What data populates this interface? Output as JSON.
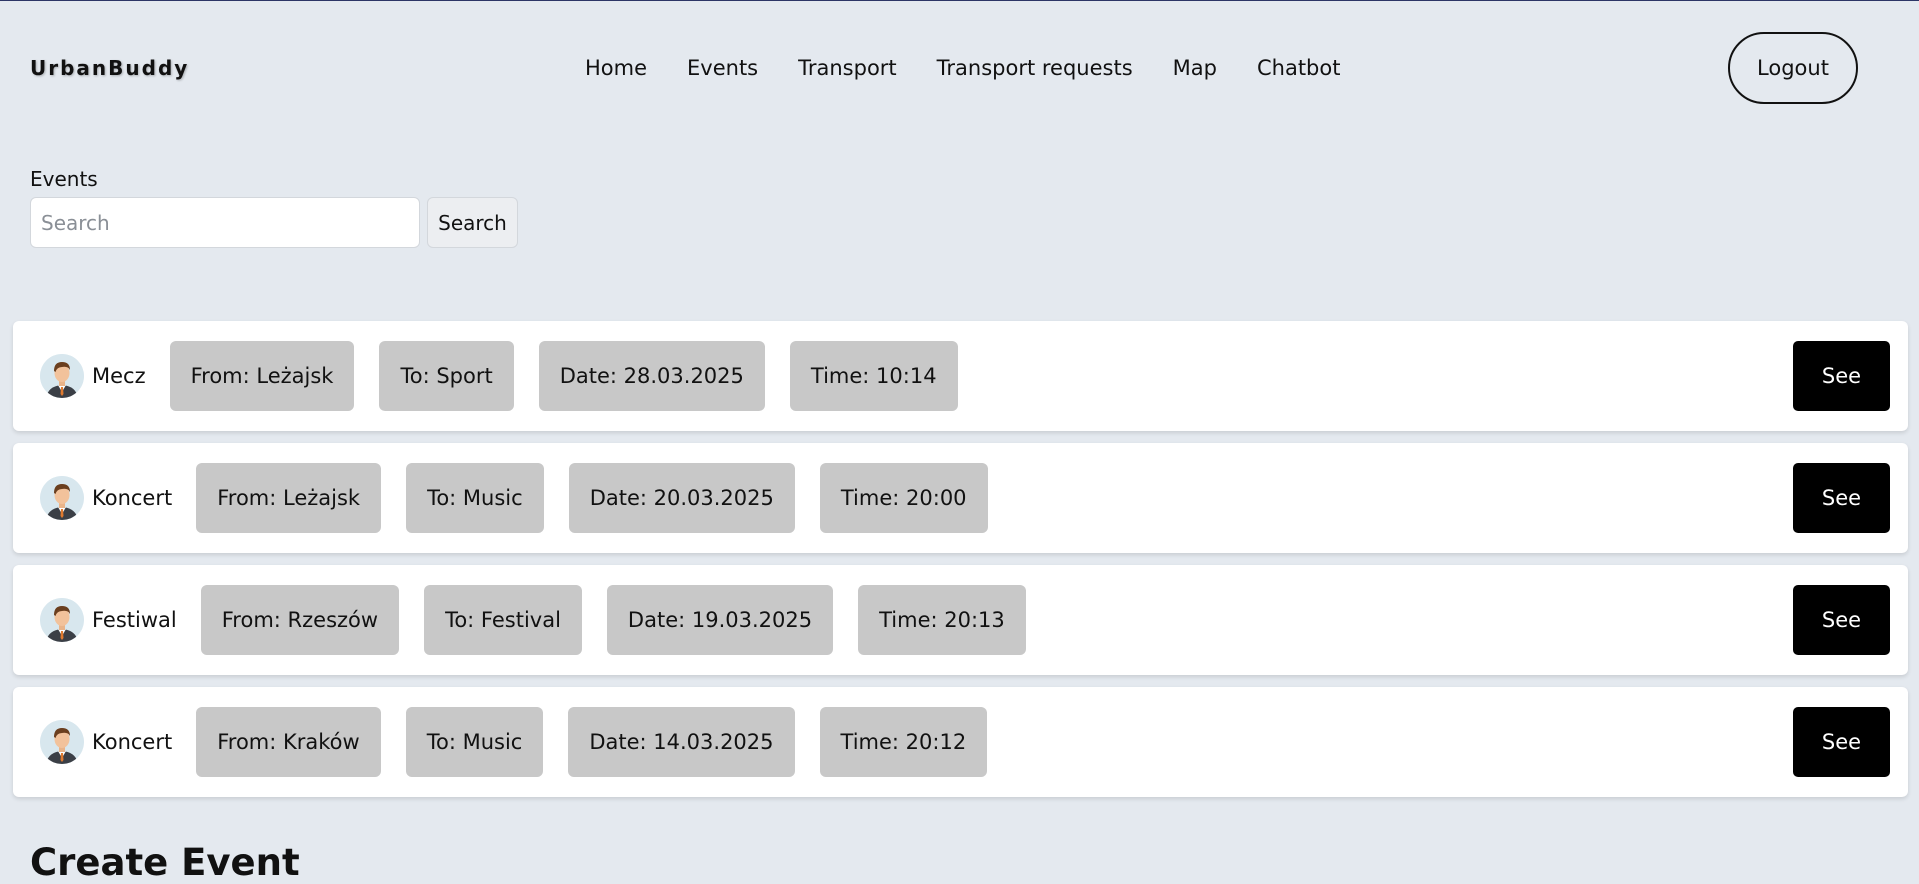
{
  "header": {
    "brand": "UrbanBuddy",
    "nav": [
      "Home",
      "Events",
      "Transport",
      "Transport requests",
      "Map",
      "Chatbot"
    ],
    "logout_label": "Logout"
  },
  "search": {
    "label": "Events",
    "placeholder": "Search",
    "value": "",
    "button_label": "Search"
  },
  "events": [
    {
      "name": "Mecz",
      "from": "From: Leżajsk",
      "to": "To: Sport",
      "date": "Date: 28.03.2025",
      "time": "Time: 10:14",
      "action": "See"
    },
    {
      "name": "Koncert",
      "from": "From: Leżajsk",
      "to": "To: Music",
      "date": "Date: 20.03.2025",
      "time": "Time: 20:00",
      "action": "See"
    },
    {
      "name": "Festiwal",
      "from": "From: Rzeszów",
      "to": "To: Festival",
      "date": "Date: 19.03.2025",
      "time": "Time: 20:13",
      "action": "See"
    },
    {
      "name": "Koncert",
      "from": "From: Kraków",
      "to": "To: Music",
      "date": "Date: 14.03.2025",
      "time": "Time: 20:12",
      "action": "See"
    }
  ],
  "create_section": {
    "heading": "Create Event"
  },
  "icons": {
    "avatar": "user-avatar-icon"
  },
  "colors": {
    "background": "#e4e9ef",
    "chip": "#c8c8c8",
    "button": "#000000"
  }
}
